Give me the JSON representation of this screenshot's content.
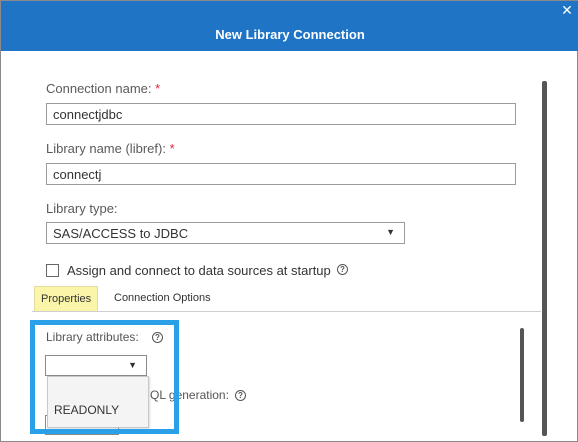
{
  "dialog": {
    "title": "New Library Connection",
    "close_glyph": "✕"
  },
  "form": {
    "connection_name": {
      "label": "Connection name:",
      "required_mark": "*",
      "value": "connectjdbc"
    },
    "library_name": {
      "label": "Library name (libref):",
      "required_mark": "*",
      "value": "connectj"
    },
    "library_type": {
      "label": "Library type:",
      "selected": "SAS/ACCESS to JDBC"
    },
    "assign_at_startup": {
      "label": "Assign and connect to data sources at startup",
      "checked": false
    }
  },
  "tabs": [
    {
      "label": "Properties",
      "active": true
    },
    {
      "label": "Connection Options",
      "active": false
    }
  ],
  "properties": {
    "library_attributes": {
      "label": "Library attributes:",
      "selected": "",
      "options": [
        "",
        "READONLY"
      ]
    },
    "sql_generation_label_visible": "QL generation:"
  },
  "icons": {
    "help": "help-icon",
    "caret": "chevron-down-icon",
    "close": "close-icon"
  },
  "colors": {
    "titlebar": "#1f74c6",
    "required": "#d9263a",
    "active_tab": "#fbf5a9",
    "highlight_box": "#29a0e7"
  }
}
